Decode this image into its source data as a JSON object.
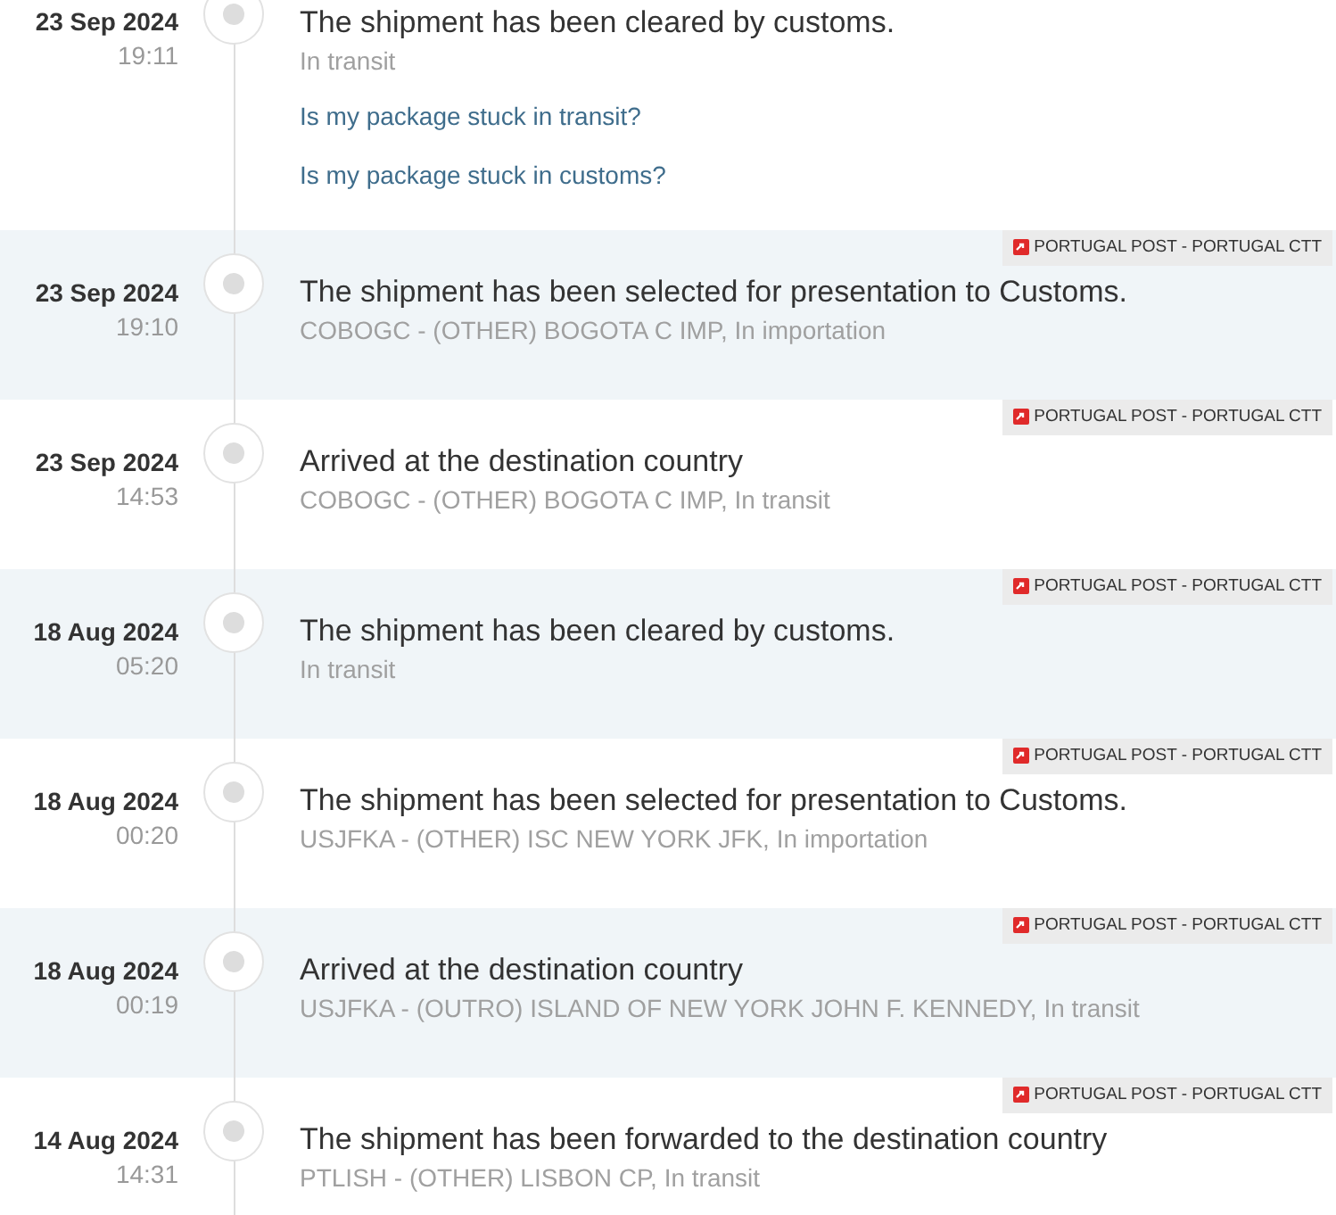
{
  "events": [
    {
      "date": "23 Sep 2024",
      "time": "19:11",
      "title": "The shipment has been cleared by customs.",
      "detail": "In transit",
      "links": [
        "Is my package stuck in transit?",
        "Is my package stuck in customs?"
      ]
    },
    {
      "date": "23 Sep 2024",
      "time": "19:10",
      "title": "The shipment has been selected for presentation to Customs.",
      "detail": "COBOGC - (OTHER) BOGOTA C IMP, In importation",
      "carrier": "PORTUGAL POST - PORTUGAL CTT"
    },
    {
      "date": "23 Sep 2024",
      "time": "14:53",
      "title": "Arrived at the destination country",
      "detail": "COBOGC - (OTHER) BOGOTA C IMP, In transit",
      "carrier": "PORTUGAL POST - PORTUGAL CTT"
    },
    {
      "date": "18 Aug 2024",
      "time": "05:20",
      "title": "The shipment has been cleared by customs.",
      "detail": "In transit",
      "carrier": "PORTUGAL POST - PORTUGAL CTT"
    },
    {
      "date": "18 Aug 2024",
      "time": "00:20",
      "title": "The shipment has been selected for presentation to Customs.",
      "detail": "USJFKA - (OTHER) ISC NEW YORK JFK, In importation",
      "carrier": "PORTUGAL POST - PORTUGAL CTT"
    },
    {
      "date": "18 Aug 2024",
      "time": "00:19",
      "title": "Arrived at the destination country",
      "detail": "USJFKA - (OUTRO) ISLAND OF NEW YORK JOHN F. KENNEDY, In transit",
      "carrier": "PORTUGAL POST - PORTUGAL CTT"
    },
    {
      "date": "14 Aug 2024",
      "time": "14:31",
      "title": "The shipment has been forwarded to the destination country",
      "detail": "PTLISH - (OTHER) LISBON CP, In transit",
      "carrier": "PORTUGAL POST - PORTUGAL CTT"
    }
  ]
}
